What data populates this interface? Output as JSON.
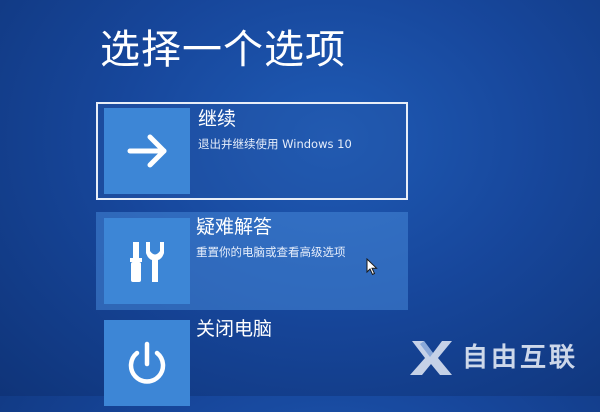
{
  "page": {
    "title": "选择一个选项"
  },
  "options": [
    {
      "title": "继续",
      "description": "退出并继续使用 Windows 10",
      "icon": "arrow-right-icon",
      "state": "selected"
    },
    {
      "title": "疑难解答",
      "description": "重置你的电脑或查看高级选项",
      "icon": "tools-icon",
      "state": "hover"
    },
    {
      "title": "关闭电脑",
      "description": "",
      "icon": "power-icon",
      "state": "normal"
    }
  ],
  "watermark": {
    "text": "自由互联",
    "icon": "x-logo-icon"
  },
  "colors": {
    "background": "#17479c",
    "tile": "#3d86d6",
    "hover_highlight": "#4687d7",
    "selected_border": "#e8eef8"
  }
}
